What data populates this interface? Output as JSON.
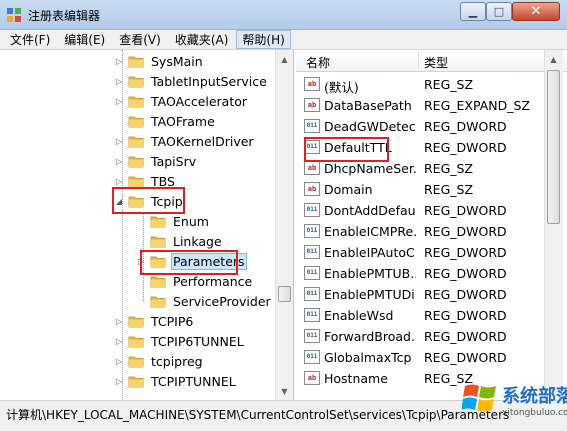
{
  "window": {
    "title": "注册表编辑器"
  },
  "menu": [
    "文件(F)",
    "编辑(E)",
    "查看(V)",
    "收藏夹(A)",
    "帮助(H)"
  ],
  "tree": [
    {
      "label": "SysMain",
      "expandable": true
    },
    {
      "label": "TabletInputService",
      "expandable": true
    },
    {
      "label": "TAOAccelerator",
      "expandable": true
    },
    {
      "label": "TAOFrame",
      "expandable": false
    },
    {
      "label": "TAOKernelDriver",
      "expandable": true
    },
    {
      "label": "TapiSrv",
      "expandable": true
    },
    {
      "label": "TBS",
      "expandable": true
    },
    {
      "label": "Tcpip",
      "expandable": true,
      "expanded": true
    },
    {
      "label": "Enum",
      "expandable": false,
      "child": true
    },
    {
      "label": "Linkage",
      "expandable": false,
      "child": true
    },
    {
      "label": "Parameters",
      "expandable": true,
      "child": true,
      "selected": true
    },
    {
      "label": "Performance",
      "expandable": false,
      "child": true
    },
    {
      "label": "ServiceProvider",
      "expandable": false,
      "child": true
    },
    {
      "label": "TCPIP6",
      "expandable": true
    },
    {
      "label": "TCPIP6TUNNEL",
      "expandable": true
    },
    {
      "label": "tcpipreg",
      "expandable": true
    },
    {
      "label": "TCPIPTUNNEL",
      "expandable": true
    }
  ],
  "list": {
    "columns": {
      "name": "名称",
      "type": "类型"
    },
    "rows": [
      {
        "name": "(默认)",
        "type": "REG_SZ",
        "icon": "string-value-icon"
      },
      {
        "name": "DataBasePath",
        "type": "REG_EXPAND_SZ",
        "icon": "string-value-icon"
      },
      {
        "name": "DeadGWDetec...",
        "type": "REG_DWORD",
        "icon": "binary-value-icon"
      },
      {
        "name": "DefaultTTL",
        "type": "REG_DWORD",
        "icon": "binary-value-icon"
      },
      {
        "name": "DhcpNameSer...",
        "type": "REG_SZ",
        "icon": "string-value-icon"
      },
      {
        "name": "Domain",
        "type": "REG_SZ",
        "icon": "string-value-icon"
      },
      {
        "name": "DontAddDefau...",
        "type": "REG_DWORD",
        "icon": "binary-value-icon"
      },
      {
        "name": "EnableICMPRe...",
        "type": "REG_DWORD",
        "icon": "binary-value-icon"
      },
      {
        "name": "EnableIPAutoC...",
        "type": "REG_DWORD",
        "icon": "binary-value-icon"
      },
      {
        "name": "EnablePMTUB...",
        "type": "REG_DWORD",
        "icon": "binary-value-icon"
      },
      {
        "name": "EnablePMTUDi...",
        "type": "REG_DWORD",
        "icon": "binary-value-icon"
      },
      {
        "name": "EnableWsd",
        "type": "REG_DWORD",
        "icon": "binary-value-icon"
      },
      {
        "name": "ForwardBroad...",
        "type": "REG_DWORD",
        "icon": "binary-value-icon"
      },
      {
        "name": "GlobalmaxTcp ...",
        "type": "REG_DWORD",
        "icon": "binary-value-icon"
      },
      {
        "name": "Hostname",
        "type": "REG_SZ",
        "icon": "string-value-icon"
      }
    ]
  },
  "icon_labels": {
    "string": "ab",
    "binary": "011"
  },
  "status": {
    "path": "计算机\\HKEY_LOCAL_MACHINE\\SYSTEM\\CurrentControlSet\\services\\Tcpip\\Parameters"
  },
  "watermark": {
    "title": "系统部落",
    "url": "xitongbuluo.com"
  },
  "colors": {
    "highlight": "#e02020",
    "folder": "#f2c94c",
    "selection": "#cde8ff"
  }
}
